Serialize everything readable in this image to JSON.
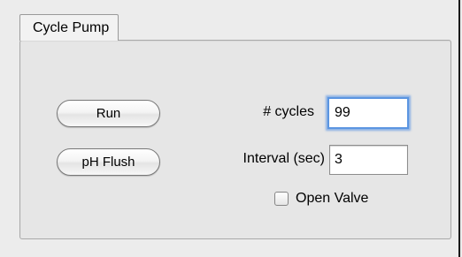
{
  "panel": {
    "title": "Cycle Pump"
  },
  "buttons": {
    "run_label": "Run",
    "ph_flush_label": "pH Flush"
  },
  "fields": {
    "cycles_label": "# cycles",
    "cycles_value": "99",
    "interval_label": "Interval (sec)",
    "interval_value": "3"
  },
  "options": {
    "open_valve_label": "Open Valve",
    "open_valve_checked": false
  },
  "colors": {
    "focus_ring": "#5b95e1",
    "panel_background": "#e6e6e6",
    "window_background": "#ececec"
  }
}
